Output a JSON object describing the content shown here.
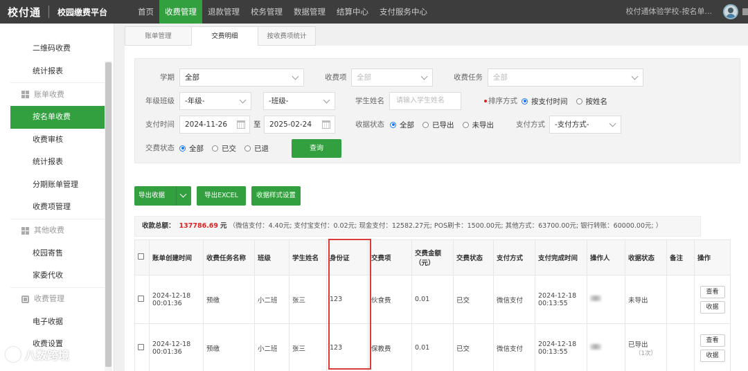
{
  "header": {
    "logo": "校付通",
    "platform": "校园缴费平台",
    "nav": [
      {
        "label": "首页",
        "active": false
      },
      {
        "label": "收费管理",
        "active": true
      },
      {
        "label": "退款管理",
        "active": false
      },
      {
        "label": "校务管理",
        "active": false
      },
      {
        "label": "数据管理",
        "active": false
      },
      {
        "label": "结算中心",
        "active": false
      },
      {
        "label": "支付服务中心",
        "active": false
      }
    ],
    "school": "校付通体验学校-按名单..."
  },
  "sidebar": {
    "items": [
      {
        "type": "item",
        "label": "二维码收费"
      },
      {
        "type": "item",
        "label": "统计报表"
      },
      {
        "type": "group",
        "label": "账单收费",
        "icon": "grid-icon"
      },
      {
        "type": "item",
        "label": "按名单收费",
        "active": true
      },
      {
        "type": "item",
        "label": "收费审核"
      },
      {
        "type": "item",
        "label": "统计报表"
      },
      {
        "type": "item",
        "label": "分期账单管理"
      },
      {
        "type": "item",
        "label": "收费项管理"
      },
      {
        "type": "group",
        "label": "其他收费",
        "icon": "grid-icon"
      },
      {
        "type": "item",
        "label": "校园寄售"
      },
      {
        "type": "item",
        "label": "家委代收"
      },
      {
        "type": "group",
        "label": "收费管理",
        "icon": "box-icon"
      },
      {
        "type": "item",
        "label": "电子收据"
      },
      {
        "type": "item",
        "label": "收费设置"
      }
    ]
  },
  "tabs": [
    {
      "label": "账单管理",
      "active": false
    },
    {
      "label": "交费明细",
      "active": true
    },
    {
      "label": "按收费项统计",
      "active": false
    }
  ],
  "filters": {
    "term_label": "学期",
    "term_value": "全部",
    "item_label": "收费项",
    "item_placeholder": "全部",
    "task_label": "收费任务",
    "task_placeholder": "全部",
    "grade_label": "年级班级",
    "grade_value": "-年级-",
    "class_value": "-班级-",
    "student_label": "学生姓名",
    "student_placeholder": "请输入学生姓名",
    "sort_label": "排序方式",
    "sort_options": [
      "按支付时间",
      "按姓名"
    ],
    "paytime_label": "支付时间",
    "date_from": "2024-11-26",
    "date_sep": "至",
    "date_to": "2025-02-24",
    "receipt_label": "收据状态",
    "receipt_options": [
      "全部",
      "已导出",
      "未导出"
    ],
    "method_label": "支付方式",
    "method_value": "-支付方式-",
    "status_label": "交费状态",
    "status_options": [
      "全部",
      "已交",
      "已退"
    ],
    "query_label": "查询"
  },
  "actions": {
    "export_receipt": "导出收据",
    "export_excel": "导出EXCEL",
    "receipt_style": "收据样式设置"
  },
  "summary": {
    "label": "收款总额：",
    "total": "137786.69",
    "unit": "元",
    "detail": "（微信支付：4.40元;  支付宝支付：0.02元;  现金支付：12582.27元;  POS刷卡：1500.00元;  其他方式：63700.00元;  银行转账：60000.00元;  ）"
  },
  "table": {
    "headers": [
      "账单创建时间",
      "收费任务名称",
      "班级",
      "学生姓名",
      "身份证",
      "交费项",
      "交费金额（元）",
      "交费状态",
      "支付方式",
      "支付完成时间",
      "操作人",
      "收据状态",
      "备注",
      "操作"
    ],
    "rows": [
      {
        "created": "2024-12-18 00:01:36",
        "task": "预缴",
        "class": "小二班",
        "student": "张三",
        "id": "123",
        "item": "伙食费",
        "amount": "0.01",
        "status": "已交",
        "method": "微信支付",
        "paid_at": "2024-12-18 00:13:55",
        "receipt": "未导出",
        "receipt_sub": "",
        "ops": [
          "查看",
          "收据"
        ]
      },
      {
        "created": "2024-12-18 00:01:36",
        "task": "预缴",
        "class": "小二班",
        "student": "张三",
        "id": "123",
        "item": "保教费",
        "amount": "0.01",
        "status": "已交",
        "method": "微信支付",
        "paid_at": "2024-12-18 00:13:55",
        "receipt": "已导出",
        "receipt_sub": "（1次）",
        "ops": [
          "查看",
          "收据"
        ]
      }
    ]
  },
  "watermark": "八数跨境"
}
